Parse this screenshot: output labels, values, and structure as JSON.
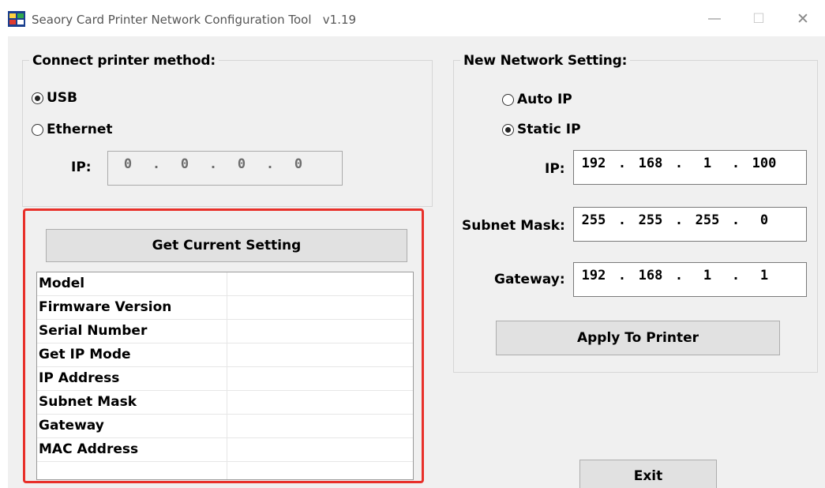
{
  "window": {
    "title": "Seaory Card Printer Network Configuration Tool   v1.19",
    "minimize_glyph": "—",
    "maximize_glyph": "☐",
    "close_glyph": "✕",
    "icon": "app-printer-icon"
  },
  "connect": {
    "legend": "Connect printer method:",
    "usb_label": "USB",
    "ethernet_label": "Ethernet",
    "selected": "USB",
    "ip_label": "IP:",
    "ip_octets": [
      "0",
      "0",
      "0",
      "0"
    ],
    "get_button": "Get Current Setting",
    "info_rows": [
      {
        "label": "Model",
        "value": ""
      },
      {
        "label": "Firmware Version",
        "value": ""
      },
      {
        "label": "Serial Number",
        "value": ""
      },
      {
        "label": "Get IP Mode",
        "value": ""
      },
      {
        "label": "IP Address",
        "value": ""
      },
      {
        "label": "Subnet Mask",
        "value": ""
      },
      {
        "label": "Gateway",
        "value": ""
      },
      {
        "label": "MAC Address",
        "value": ""
      },
      {
        "label": "",
        "value": ""
      }
    ]
  },
  "network": {
    "legend": "New Network Setting:",
    "auto_label": "Auto IP",
    "static_label": "Static IP",
    "selected": "Static IP",
    "ip_label": "IP:",
    "ip_octets": [
      "192",
      "168",
      "1",
      "100"
    ],
    "mask_label": "Subnet Mask:",
    "mask_octets": [
      "255",
      "255",
      "255",
      "0"
    ],
    "gateway_label": "Gateway:",
    "gateway_octets": [
      "192",
      "168",
      "1",
      "1"
    ],
    "apply_button": "Apply To Printer"
  },
  "exit_button": "Exit",
  "colors": {
    "highlight": "#e8302a",
    "window_bg": "#f0f0f0",
    "button_bg": "#e1e1e1"
  }
}
